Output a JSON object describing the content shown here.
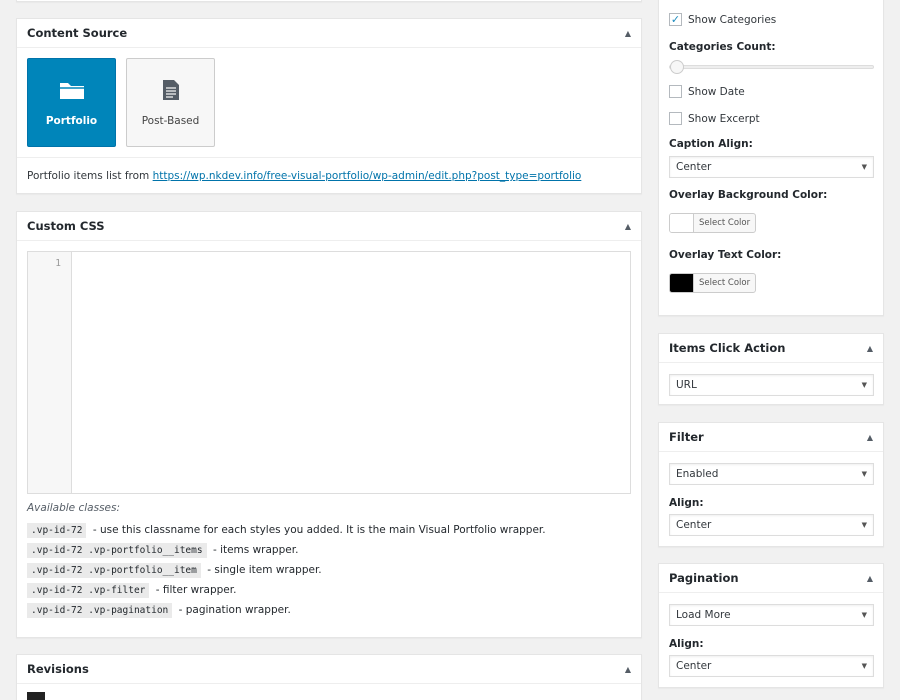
{
  "content_source": {
    "title": "Content Source",
    "options": [
      {
        "label": "Portfolio",
        "icon": "folder-icon",
        "active": true
      },
      {
        "label": "Post-Based",
        "icon": "document-icon",
        "active": false
      }
    ],
    "info_text": "Portfolio items list from ",
    "info_link": "https://wp.nkdev.info/free-visual-portfolio/wp-admin/edit.php?post_type=portfolio"
  },
  "custom_css": {
    "title": "Custom CSS",
    "line_number": "1",
    "available_caption": "Available classes:",
    "classes": [
      {
        "code": ".vp-id-72",
        "desc": "- use this classname for each styles you added. It is the main Visual Portfolio wrapper."
      },
      {
        "code": ".vp-id-72 .vp-portfolio__items",
        "desc": "- items wrapper."
      },
      {
        "code": ".vp-id-72 .vp-portfolio__item",
        "desc": "- single item wrapper."
      },
      {
        "code": ".vp-id-72 .vp-filter",
        "desc": "- filter wrapper."
      },
      {
        "code": ".vp-id-72 .vp-pagination",
        "desc": "- pagination wrapper."
      }
    ]
  },
  "revisions": {
    "title": "Revisions"
  },
  "layout_options": {
    "show_categories_label": "Show Categories",
    "show_categories_checked": true,
    "categories_count_label": "Categories Count:",
    "categories_count_value": 0,
    "show_date_label": "Show Date",
    "show_excerpt_label": "Show Excerpt",
    "caption_align_label": "Caption Align:",
    "caption_align_value": "Center",
    "overlay_bg_label": "Overlay Background Color:",
    "overlay_bg_color": "#ffffff",
    "overlay_text_label": "Overlay Text Color:",
    "overlay_text_color": "#000000",
    "select_color_label": "Select Color"
  },
  "items_click_action": {
    "title": "Items Click Action",
    "value": "URL"
  },
  "filter": {
    "title": "Filter",
    "value": "Enabled",
    "align_label": "Align:",
    "align_value": "Center"
  },
  "pagination": {
    "title": "Pagination",
    "value": "Load More",
    "align_label": "Align:",
    "align_value": "Center"
  },
  "colors": {
    "accent": "#0085ba",
    "link": "#0073aa",
    "checkmark": "#1e8cbe"
  }
}
